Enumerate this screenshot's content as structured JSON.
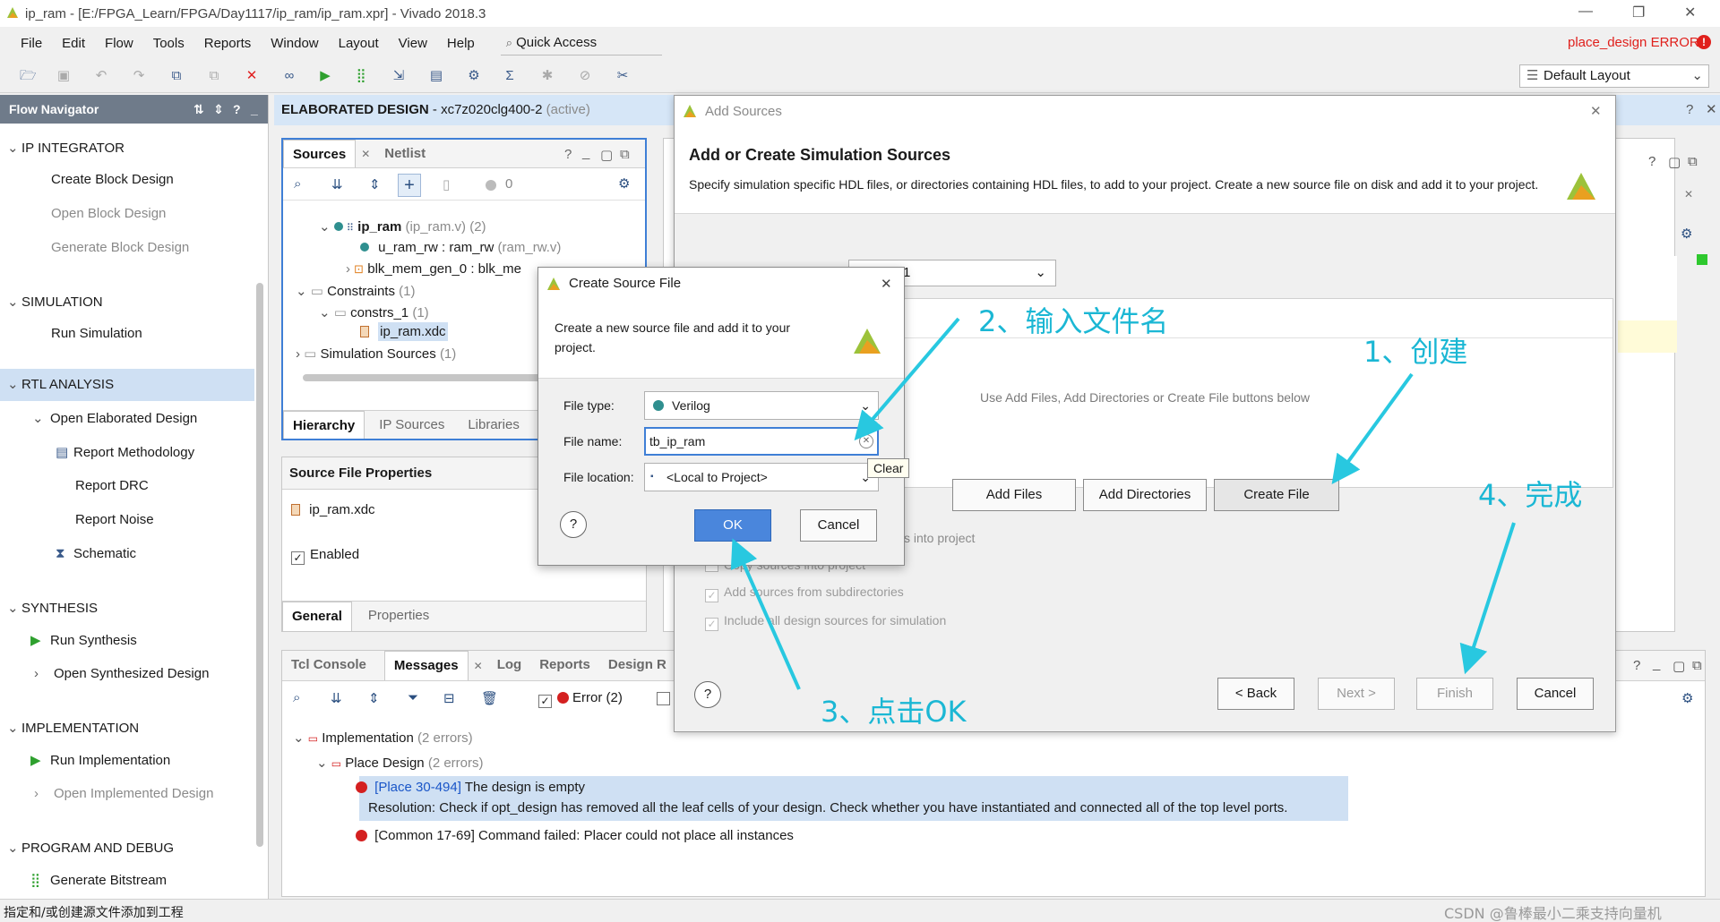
{
  "window": {
    "title": "ip_ram - [E:/FPGA_Learn/FPGA/Day1117/ip_ram/ip_ram.xpr] - Vivado 2018.3",
    "status_error": "place_design ERROR",
    "layout_select": "Default Layout"
  },
  "menu": [
    "File",
    "Edit",
    "Flow",
    "Tools",
    "Reports",
    "Window",
    "Layout",
    "View",
    "Help"
  ],
  "quick_access": "Quick Access",
  "flow_navigator": {
    "title": "Flow Navigator",
    "sections": [
      {
        "label": "IP INTEGRATOR",
        "items": [
          "Create Block Design",
          "Open Block Design",
          "Generate Block Design"
        ]
      },
      {
        "label": "SIMULATION",
        "items": [
          "Run Simulation"
        ]
      },
      {
        "label": "RTL ANALYSIS",
        "items": [
          "Open Elaborated Design",
          "Report Methodology",
          "Report DRC",
          "Report Noise",
          "Schematic"
        ]
      },
      {
        "label": "SYNTHESIS",
        "items": [
          "Run Synthesis",
          "Open Synthesized Design"
        ]
      },
      {
        "label": "IMPLEMENTATION",
        "items": [
          "Run Implementation",
          "Open Implemented Design"
        ]
      },
      {
        "label": "PROGRAM AND DEBUG",
        "items": [
          "Generate Bitstream"
        ]
      }
    ]
  },
  "elab_header": {
    "title": "ELABORATED DESIGN",
    "part": "- xc7z020clg400-2",
    "state": "(active)"
  },
  "sources": {
    "tabs": [
      "Sources",
      "Netlist"
    ],
    "count": "0",
    "tree": [
      {
        "name": "ip_ram",
        "meta": "(ip_ram.v) (2)"
      },
      {
        "name": "u_ram_rw : ram_rw",
        "meta": "(ram_rw.v)"
      },
      {
        "name": "blk_mem_gen_0 : blk_me",
        "meta": ""
      },
      {
        "name": "Constraints",
        "meta": "(1)"
      },
      {
        "name": "constrs_1",
        "meta": "(1)"
      },
      {
        "name": "ip_ram.xdc",
        "meta": ""
      },
      {
        "name": "Simulation Sources",
        "meta": "(1)"
      }
    ],
    "bottom_tabs": [
      "Hierarchy",
      "IP Sources",
      "Libraries"
    ]
  },
  "source_props": {
    "title": "Source File Properties",
    "file": "ip_ram.xdc",
    "enabled": "Enabled",
    "tabs": [
      "General",
      "Properties"
    ]
  },
  "messages": {
    "tabs": [
      "Tcl Console",
      "Messages",
      "Log",
      "Reports",
      "Design R"
    ],
    "error_filter": "Error (2)",
    "tree": [
      {
        "label": "Implementation",
        "meta": "(2 errors)"
      },
      {
        "label": "Place Design",
        "meta": "(2 errors)"
      }
    ],
    "msg1_link": "[Place 30-494]",
    "msg1_text": "The design is empty",
    "msg1_resolution": "Resolution: Check if opt_design has removed all the leaf cells of your design. Check whether you have instantiated and connected all of the top level ports.",
    "msg2_text": "[Common 17-69] Command failed: Placer could not place all instances"
  },
  "add_sources": {
    "title": "Add Sources",
    "heading": "Add or Create Simulation Sources",
    "desc": "Specify simulation specific HDL files, or directories containing HDL files, to add to your project. Create a new source file on disk and add it to your project.",
    "set_value": "1",
    "empty_hint": "Use Add Files, Add Directories or Create File buttons below",
    "btn_add_files": "Add Files",
    "btn_add_dirs": "Add Directories",
    "btn_create_file": "Create File",
    "opt_scan": "s into project",
    "opt_copy": "Copy sources into project",
    "opt_subdirs": "Add sources from subdirectories",
    "opt_include": "Include all design sources for simulation",
    "btn_back": "< Back",
    "btn_next": "Next >",
    "btn_finish": "Finish",
    "btn_cancel": "Cancel"
  },
  "create_source": {
    "title": "Create Source File",
    "desc": "Create a new source file and add it to your project.",
    "file_type_label": "File type:",
    "file_type": "Verilog",
    "file_name_label": "File name:",
    "file_name": "tb_ip_ram",
    "file_location_label": "File location:",
    "file_location": "<Local to Project>",
    "clear_tip": "Clear",
    "btn_ok": "OK",
    "btn_cancel": "Cancel"
  },
  "annotations": {
    "step1": "1、创建",
    "step2": "2、输入文件名",
    "step3": "3、点击OK",
    "step4": "4、完成"
  },
  "status_bar": "指定和/或创建源文件添加到工程",
  "watermark": "CSDN @鲁棒最小二乘支持向量机"
}
